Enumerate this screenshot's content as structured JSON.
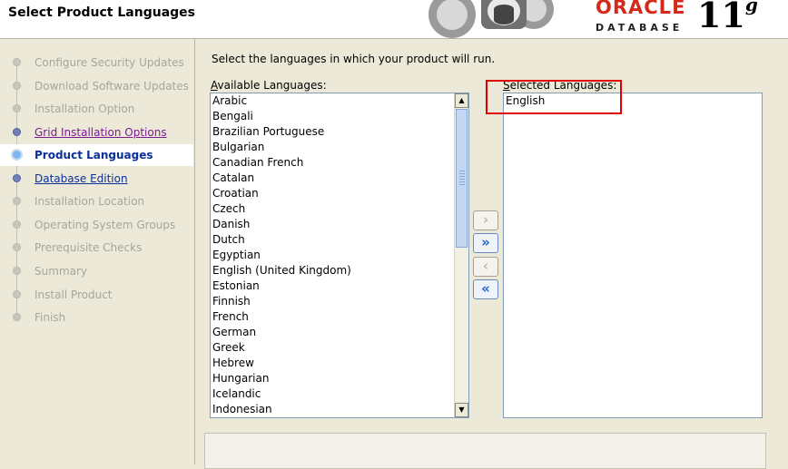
{
  "window": {
    "title": "Select Product Languages"
  },
  "branding": {
    "oracle": "ORACLE",
    "database": "DATABASE",
    "version": "11",
    "version_suffix": "g",
    "brand_color": "#d42a1c"
  },
  "steps": [
    {
      "label": "Configure Security Updates",
      "state": "inactive"
    },
    {
      "label": "Download Software Updates",
      "state": "inactive"
    },
    {
      "label": "Installation Option",
      "state": "inactive"
    },
    {
      "label": "Grid Installation Options",
      "state": "visited"
    },
    {
      "label": "Product Languages",
      "state": "current"
    },
    {
      "label": "Database Edition",
      "state": "link"
    },
    {
      "label": "Installation Location",
      "state": "inactive"
    },
    {
      "label": "Operating System Groups",
      "state": "inactive"
    },
    {
      "label": "Prerequisite Checks",
      "state": "inactive"
    },
    {
      "label": "Summary",
      "state": "inactive"
    },
    {
      "label": "Install Product",
      "state": "inactive"
    },
    {
      "label": "Finish",
      "state": "inactive"
    }
  ],
  "main": {
    "instruction": "Select the languages in which your product will run.",
    "available_label_mnemonic": "A",
    "available_label_rest": "vailable Languages:",
    "selected_label_mnemonic": "S",
    "selected_label_rest": "elected Languages:",
    "available_languages": [
      "Arabic",
      "Bengali",
      "Brazilian Portuguese",
      "Bulgarian",
      "Canadian French",
      "Catalan",
      "Croatian",
      "Czech",
      "Danish",
      "Dutch",
      "Egyptian",
      "English (United Kingdom)",
      "Estonian",
      "Finnish",
      "French",
      "German",
      "Greek",
      "Hebrew",
      "Hungarian",
      "Icelandic",
      "Indonesian"
    ],
    "selected_languages": [
      "English"
    ],
    "buttons": {
      "move_right": "›",
      "move_all_right": "»",
      "move_left": "‹",
      "move_all_left": "«"
    }
  },
  "icons": {
    "scroll_up": "▲",
    "scroll_down": "▼"
  },
  "highlight_color": "#e00000"
}
